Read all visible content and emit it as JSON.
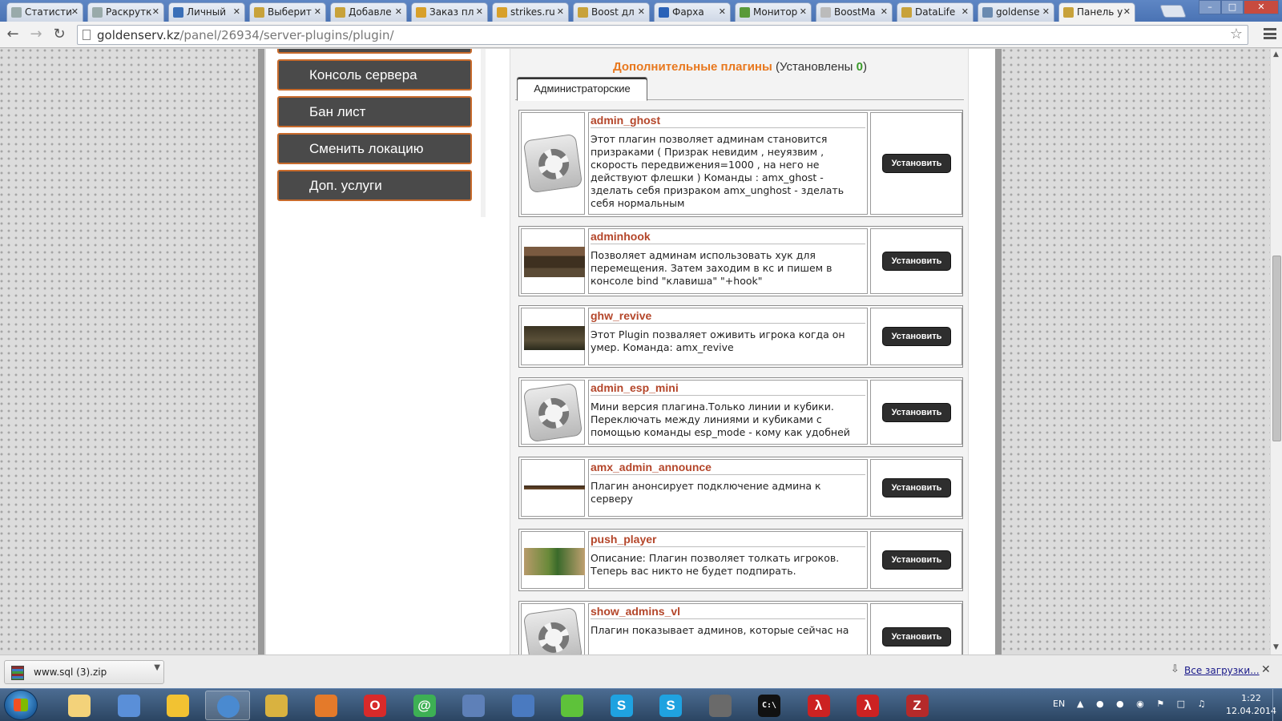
{
  "browser": {
    "tabs": [
      {
        "label": "Статисти",
        "favicon": "page-icon"
      },
      {
        "label": "Раскрутк",
        "favicon": "page-icon"
      },
      {
        "label": "Личный",
        "favicon": "folder-icon"
      },
      {
        "label": "Выберит",
        "favicon": "cs-icon"
      },
      {
        "label": "Добавле",
        "favicon": "cs-icon"
      },
      {
        "label": "Заказ пл",
        "favicon": "globe-icon"
      },
      {
        "label": "strikes.ru",
        "favicon": "globe-icon"
      },
      {
        "label": "Boost дл",
        "favicon": "cs-icon"
      },
      {
        "label": "Фарха",
        "favicon": "video-icon"
      },
      {
        "label": "Монитор",
        "favicon": "monitor-icon"
      },
      {
        "label": "BoostMa",
        "favicon": "spinner-icon"
      },
      {
        "label": "DataLife",
        "favicon": "cs-icon"
      },
      {
        "label": "goldense",
        "favicon": "ru-icon"
      },
      {
        "label": "Панель у",
        "favicon": "cs-icon"
      }
    ],
    "url_host": "goldenserv.kz",
    "url_path": "/panel/26934/server-plugins/plugin/"
  },
  "sidebar": {
    "items": [
      {
        "label": "Консоль сервера"
      },
      {
        "label": "Бан лист"
      },
      {
        "label": "Сменить локацию"
      },
      {
        "label": "Доп. услуги"
      }
    ]
  },
  "content": {
    "heading": "Дополнительные плагины",
    "installed_prefix": "(Установлены",
    "installed_count": "0",
    "installed_suffix": ")",
    "category_tab": "Администраторские",
    "install_label": "Установить",
    "plugins": [
      {
        "name": "admin_ghost",
        "thumb": "gear-icon",
        "description": "Этот плагин позволяет админам становится призраками ( Призрак невидим , неуязвим , скорость передвижения=1000 , на него не действуют флешки ) Команды : amx_ghost - зделать себя призраком amx_unghost - зделать себя нормальным"
      },
      {
        "name": "adminhook",
        "thumb": "screenshot",
        "description": "Позволяет админам использовать хук для перемещения. Затем заходим в кс и пишем в консоле bind \"клавиша\" \"+hook\""
      },
      {
        "name": "ghw_revive",
        "thumb": "screenshot",
        "description": "Этот Plugin позваляет оживить игрока когда он умер. Команда: amx_revive"
      },
      {
        "name": "admin_esp_mini",
        "thumb": "gear-icon",
        "description": "Мини версия плагина.Только линии и кубики. Переключать между линиями и кубиками с помощью команды esp_mode - кому как удобней"
      },
      {
        "name": "amx_admin_announce",
        "thumb": "screenshot",
        "description": "Плагин анонсирует подключение админа к серверу"
      },
      {
        "name": "push_player",
        "thumb": "screenshot",
        "description": "Описание: Плагин позволяет толкать игроков. Теперь вас никто не будет подпирать."
      },
      {
        "name": "show_admins_vl",
        "thumb": "gear-icon",
        "description": "Плагин показывает админов, которые сейчас на"
      }
    ]
  },
  "downloads": {
    "file_name": "www.sql (3).zip",
    "all_downloads": "Все загрузки..."
  },
  "taskbar": {
    "apps": [
      {
        "name": "explorer",
        "glyph": ""
      },
      {
        "name": "media-player",
        "glyph": ""
      },
      {
        "name": "fruit-app",
        "glyph": ""
      },
      {
        "name": "chrome",
        "glyph": ""
      },
      {
        "name": "spy-app",
        "glyph": ""
      },
      {
        "name": "flash-app",
        "glyph": ""
      },
      {
        "name": "opera",
        "glyph": "O"
      },
      {
        "name": "mail-agent",
        "glyph": "@"
      },
      {
        "name": "network-app",
        "glyph": ""
      },
      {
        "name": "connection-app",
        "glyph": ""
      },
      {
        "name": "icq",
        "glyph": ""
      },
      {
        "name": "skype-1",
        "glyph": "S"
      },
      {
        "name": "skype-2",
        "glyph": "S"
      },
      {
        "name": "counter-strike",
        "glyph": ""
      },
      {
        "name": "cmd",
        "glyph": "C:\\"
      },
      {
        "name": "half-life-1",
        "glyph": "λ"
      },
      {
        "name": "half-life-2",
        "glyph": "λ"
      },
      {
        "name": "filezilla",
        "glyph": "Z"
      }
    ],
    "language": "EN",
    "time": "1:22",
    "date": "12.04.2014"
  }
}
